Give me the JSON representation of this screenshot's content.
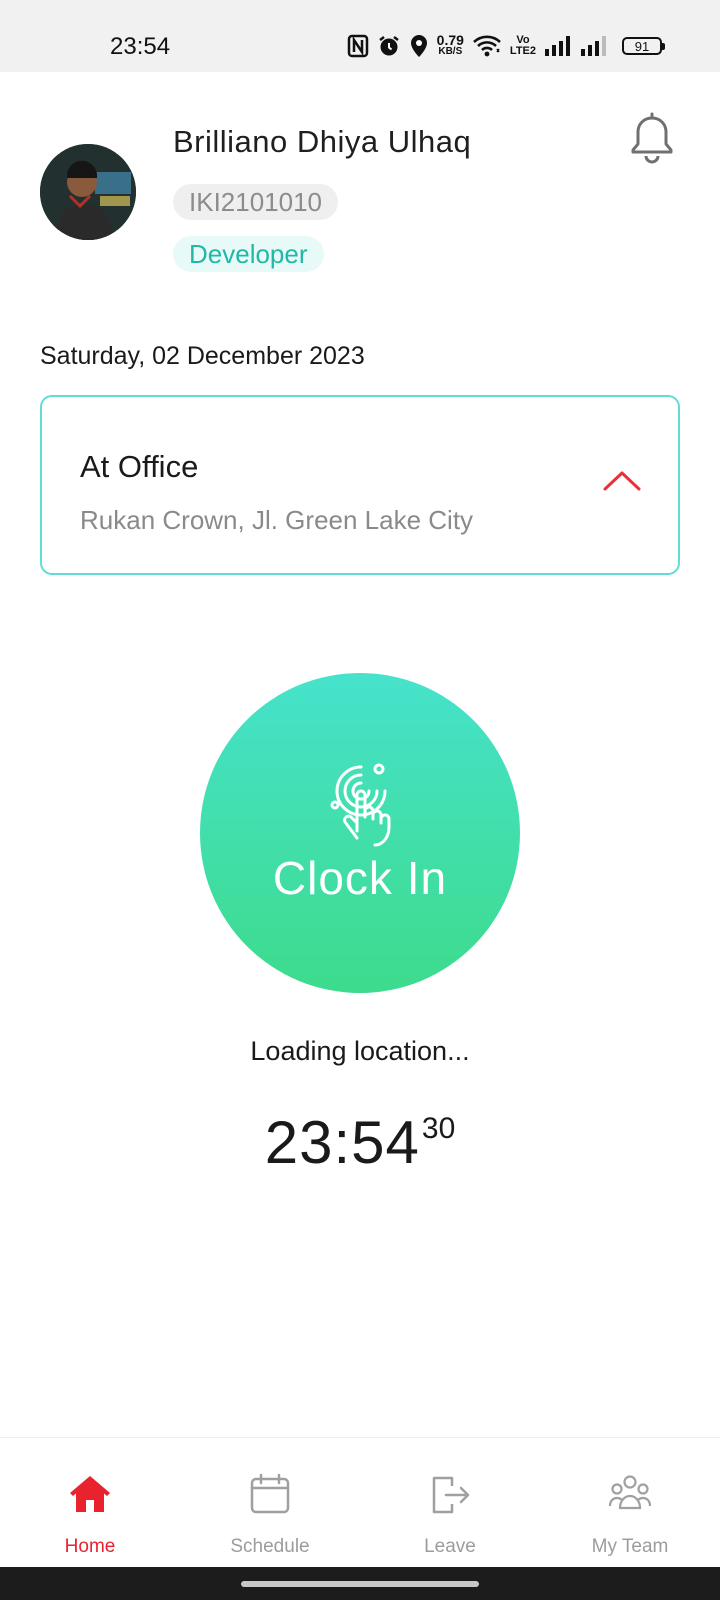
{
  "status_bar": {
    "time": "23:54",
    "net_speed_value": "0.79",
    "net_speed_unit": "KB/S",
    "volte_top": "Vo",
    "volte_bottom": "LTE2",
    "battery": "91"
  },
  "profile": {
    "name": "Brilliano Dhiya Ulhaq",
    "employee_id": "IKI2101010",
    "role": "Developer"
  },
  "date": "Saturday, 02 December 2023",
  "location": {
    "title": "At Office",
    "address": "Rukan Crown, Jl. Green Lake City"
  },
  "clock_button": {
    "label": "Clock In"
  },
  "status_message": "Loading location...",
  "current_time": {
    "hours_minutes": "23:54",
    "seconds": "30"
  },
  "bottom_nav": {
    "items": [
      {
        "label": "Home",
        "icon": "home-icon",
        "active": true
      },
      {
        "label": "Schedule",
        "icon": "calendar-icon",
        "active": false
      },
      {
        "label": "Leave",
        "icon": "exit-icon",
        "active": false
      },
      {
        "label": "My Team",
        "icon": "team-icon",
        "active": false
      }
    ]
  },
  "colors": {
    "accent_red": "#e8232e",
    "teal_border": "#62dcd6",
    "button_gradient_top": "#46e2cc",
    "button_gradient_bottom": "#3ddb8c",
    "role_text": "#21b8a8"
  }
}
